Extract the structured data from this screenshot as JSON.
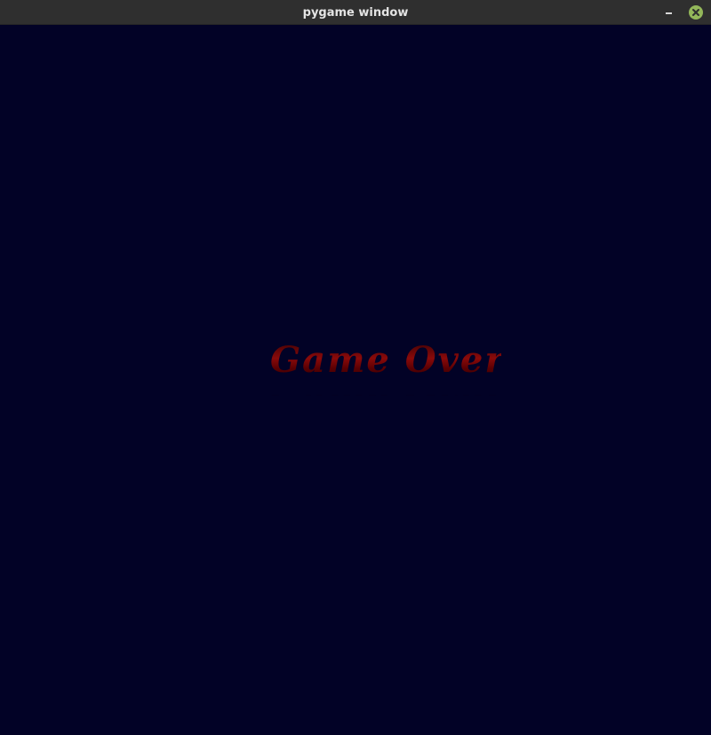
{
  "window": {
    "title": "pygame window",
    "minimize_icon": "minimize-icon",
    "close_icon": "close-icon",
    "close_button_color": "#93b75a"
  },
  "game": {
    "background_color": "#020226",
    "message": "Game Over",
    "message_color": "#8a0a0a"
  }
}
